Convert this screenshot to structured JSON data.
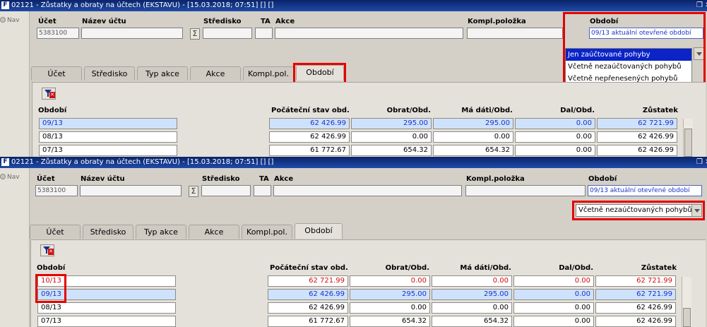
{
  "window": {
    "title": "02121 - Zůstatky a obraty na účtech (EKSTAVU) - [15.03.2018; 07:51] [] []",
    "app_icon": "F",
    "control_icon": "restore-close-icon",
    "control_glyph": "❐ ✕"
  },
  "nav": {
    "label": "Nav"
  },
  "filters": {
    "ucet_label": "Účet",
    "ucet_value": "5383100",
    "nazev_label": "Název účtu",
    "sigma": "Σ",
    "stredisko_label": "Středisko",
    "ta_label": "TA",
    "akce_label": "Akce",
    "kompl_label": "Kompl.položka",
    "obdobi_label": "Období",
    "obdobi_value": "09/13 aktuální otevřené období"
  },
  "dropdown_panel1": {
    "options": [
      "Jen zaúčtované pohyby",
      "Včetně nezaúčtovaných pohybů",
      "Včetně nepřenesených pohybů"
    ],
    "highlighted_index": 0
  },
  "select_panel2": {
    "value": "Včetně nezaúčtovaných pohybů"
  },
  "tabs": [
    {
      "label": "Účet"
    },
    {
      "label": "Středisko"
    },
    {
      "label": "Typ akce"
    },
    {
      "label": "Akce"
    },
    {
      "label": "Kompl.pol."
    },
    {
      "label": "Období"
    }
  ],
  "active_tab_index": 5,
  "table": {
    "columns": [
      "Období",
      "Počáteční stav obd.",
      "Obrat/Obd.",
      "Má dáti/Obd.",
      "Dal/Obd.",
      "Zůstatek"
    ]
  },
  "rows_panel1": [
    {
      "obdobi": "09/13",
      "pocatecni": "62 426.99",
      "obrat": "295.00",
      "madati": "295.00",
      "dal": "0.00",
      "zustatek": "62 721.99",
      "style": "sel"
    },
    {
      "obdobi": "08/13",
      "pocatecni": "62 426.99",
      "obrat": "0.00",
      "madati": "0.00",
      "dal": "0.00",
      "zustatek": "62 426.99",
      "style": ""
    },
    {
      "obdobi": "07/13",
      "pocatecni": "61 772.67",
      "obrat": "654.32",
      "madati": "654.32",
      "dal": "0.00",
      "zustatek": "62 426.99",
      "style": ""
    }
  ],
  "rows_panel2": [
    {
      "obdobi": "10/13",
      "pocatecni": "62 721.99",
      "obrat": "0.00",
      "madati": "0.00",
      "dal": "0.00",
      "zustatek": "62 721.99",
      "style": "red"
    },
    {
      "obdobi": "09/13",
      "pocatecni": "62 426.99",
      "obrat": "295.00",
      "madati": "295.00",
      "dal": "0.00",
      "zustatek": "62 721.99",
      "style": "sel"
    },
    {
      "obdobi": "08/13",
      "pocatecni": "62 426.99",
      "obrat": "0.00",
      "madati": "0.00",
      "dal": "0.00",
      "zustatek": "62 426.99",
      "style": ""
    },
    {
      "obdobi": "07/13",
      "pocatecni": "61 772.67",
      "obrat": "654.32",
      "madati": "654.32",
      "dal": "0.00",
      "zustatek": "62 426.99",
      "style": ""
    }
  ],
  "colors": {
    "highlight_red": "#e60000",
    "selected_row_bg": "#cfe2fb",
    "selected_text": "#1a32c8",
    "unposted_text": "#d01010",
    "titlebar": "#0a246a"
  }
}
